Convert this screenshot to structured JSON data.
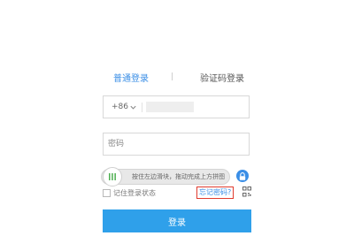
{
  "colors": {
    "accent": "#3a8ee6",
    "button": "#2fa0ea",
    "forgot_border": "#e03b2e"
  },
  "tabs": {
    "normal_label": "普通登录",
    "sms_label": "验证码登录"
  },
  "phone": {
    "country_code": "+86",
    "number_value": ""
  },
  "password": {
    "placeholder": "密码"
  },
  "slider": {
    "hint": "按住左边滑块，拖动完成上方拼图",
    "lock_icon": "lock-icon"
  },
  "remember": {
    "label": "记住登录状态",
    "checked": false
  },
  "forgot": {
    "label": "忘记密码?"
  },
  "icons": {
    "qr": "qr-code-icon",
    "chevron": "chevron-down-icon",
    "grip": "grip-icon"
  },
  "login": {
    "label": "登录"
  }
}
